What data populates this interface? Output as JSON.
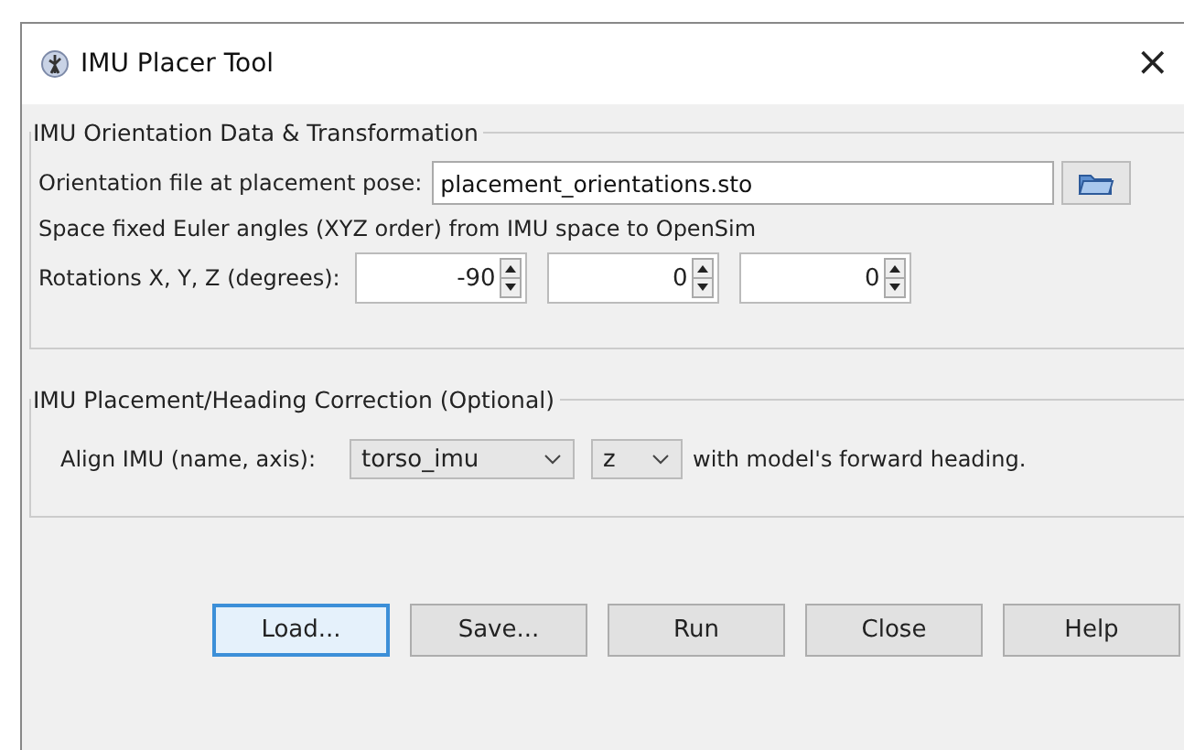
{
  "window": {
    "title": "IMU Placer Tool",
    "close": "×"
  },
  "orientation_group": {
    "title": "IMU Orientation Data & Transformation",
    "file_label": "Orientation file at placement pose:",
    "file_value": "placement_orientations.sto",
    "note": "Space fixed Euler angles (XYZ order) from IMU space to OpenSim",
    "rotations_label": "Rotations X, Y, Z (degrees):",
    "rotations": [
      {
        "value": "-90"
      },
      {
        "value": "0"
      },
      {
        "value": "0"
      }
    ]
  },
  "heading_group": {
    "title": "IMU Placement/Heading Correction (Optional)",
    "align_label": "Align IMU (name, axis):",
    "imu_value": "torso_imu",
    "axis_value": "z",
    "suffix": "with model's forward heading."
  },
  "buttons": [
    {
      "label": "Load...",
      "default": true
    },
    {
      "label": "Save...",
      "default": false
    },
    {
      "label": "Run",
      "default": false
    },
    {
      "label": "Close",
      "default": false
    },
    {
      "label": "Help",
      "default": false
    }
  ]
}
